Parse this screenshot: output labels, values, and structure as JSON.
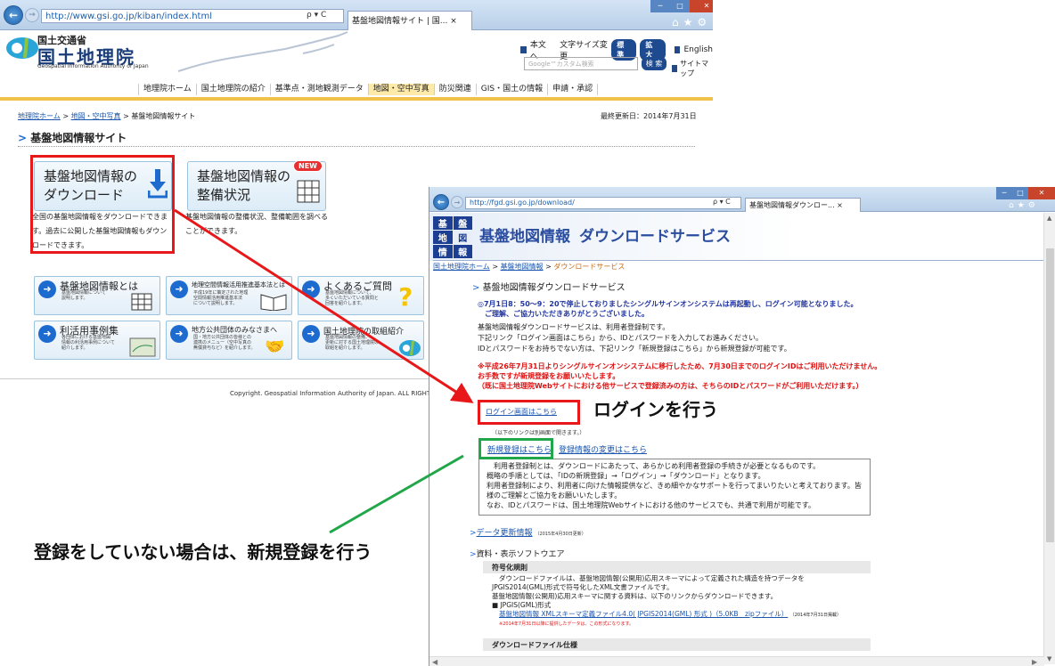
{
  "window1": {
    "url": "http://www.gsi.go.jp/kiban/index.html",
    "url_highlight": "gsi.go.jp",
    "tab_title": "基盤地図情報サイト | 国...",
    "logo": {
      "line1": "国土交通省",
      "line2": "国土地理院",
      "line3": "Geospatial Information Authority of Japan"
    },
    "header_links": {
      "text_only": "本文へ",
      "font_size": "文字サイズ変更",
      "std": "標 準",
      "large": "拡 大",
      "english": "English"
    },
    "search_placeholder": "Google™カスタム検索",
    "search_button": "検 索",
    "sitemap": "サイトマップ",
    "global_nav": [
      "地理院ホーム",
      "国土地理院の紹介",
      "基準点・測地観測データ",
      "地図・空中写真",
      "防災関連",
      "GIS・国土の情報",
      "申請・承認"
    ],
    "breadcrumb": {
      "home": "地理院ホーム",
      "sep": ">",
      "level2": "地図・空中写真",
      "current": "基盤地図情報サイト"
    },
    "last_updated": "最終更新日：2014年7月31日",
    "page_title": "基盤地図情報サイト",
    "download_tile": {
      "title_line1": "基盤地図情報の",
      "title_line2": "ダウンロード",
      "desc": "全国の基盤地図情報をダウンロードできます。過去に公開した基盤地図情報もダウンロードできます。"
    },
    "status_tile": {
      "title_line1": "基盤地図情報の",
      "title_line2": "整備状況",
      "new_badge": "NEW",
      "desc": "基盤地図情報の整備状況、整備範囲を調べることができます。"
    },
    "nav_tiles": [
      {
        "title": "基盤地図情報とは",
        "sub": "基盤地図情報について\n説明します。"
      },
      {
        "title": "地理空間情報活用推進基本法とは",
        "sub": "平成19年に策定された地理\n空間情報活用推進基本法\nについて説明します。"
      },
      {
        "title": "よくあるご質問",
        "sub": "基盤地図情報について、\n多くいただいている質問と\n回答を紹介します。"
      },
      {
        "title": "利活用事例集",
        "sub": "各団体における基盤地図\n情報の利活用事例について\n紹介します。"
      },
      {
        "title": "地方公共団体のみなさまへ",
        "sub": "国・地方公共団体の皆様との\n連携のメニュー（空中写真の\n無償貸与など）を紹介します。"
      },
      {
        "title": "国土地理院の取組紹介",
        "sub": "基盤地図情報の整備、\n更新に対する国土地理院の\n取組を紹介します。"
      }
    ],
    "copyright": "Copyright. Geospatial Information Authority of Japan. ALL RIGHT"
  },
  "window2": {
    "url": "http://fgd.gsi.go.jp/download/",
    "url_highlight": "gsi.go.jp",
    "tab_title": "基盤地図情報ダウンロー...",
    "banner_logo": {
      "a": "基",
      "b": "盤",
      "c": "地",
      "d": "図",
      "e": "情",
      "f": "報"
    },
    "banner_title": "基盤地図情報",
    "banner_subtitle": "ダウンロードサービス",
    "breadcrumb": {
      "home": "国土地理院ホーム",
      "sep": ">",
      "level2": "基盤地図情報",
      "current": "ダウンロードサービス"
    },
    "service_title": "基盤地図情報ダウンロードサービス",
    "notice_line1": "◎7月1日8：50～9：20で停止しておりましたシングルサインオンシステムは再起動し、ログイン可能となりました。",
    "notice_line2": "ご理解、ご協力いただきありがとうございました。",
    "intro_line1": "基盤地図情報ダウンロードサービスは、利用者登録制です。",
    "intro_line2": "下記リンク「ログイン画面はこちら」から、IDとパスワードを入力してお進みください。",
    "intro_line3": "IDとパスワードをお持ちでない方は、下記リンク「新規登録はこちら」から新規登録が可能です。",
    "red_line1": "※平成26年7月31日よりシングルサインオンシステムに移行したため、7月30日までのログインIDはご利用いただけません。",
    "red_line2": "お手数ですが新規登録をお願いいたします。",
    "red_line3": "（既に国土地理院Webサイトにおける他サービスで登録済みの方は、そちらのIDとパスワードがご利用いただけます。）",
    "login_link": "ログイン画面はこちら",
    "link_note": "（以下のリンクは別画面で開きます。）",
    "register_link": "新規登録はこちら",
    "change_link": "登録情報の変更はこちら",
    "box_line1": "利用者登録制とは、ダウンロードにあたって、あらかじめ利用者登録の手続きが必要となるものです。",
    "box_line2": "概略の手順としては、「IDの新規登録」→「ログイン」→「ダウンロード」となります。",
    "box_line3": "利用者登録制により、利用者に向けた情報提供など、きめ細やかなサポートを行ってまいりたいと考えております。皆",
    "box_line4": "様のご理解とご協力をお願いいたします。",
    "box_line5": "なお、IDとパスワードは、国土地理院Webサイトにおける他のサービスでも、共通で利用が可能です。",
    "update_link": "データ更新情報",
    "update_date": "（2015年4月30日更新）",
    "software_title": "資料・表示ソフトウエア",
    "section1_title": "符号化規則",
    "s1_line1": "ダウンロードファイルは、基盤地図情報(公開用)応用スキーマによって定義された構造を持つデータを",
    "s1_line2": "JPGIS2014(GML)形式で符号化したXML文書ファイルです。",
    "s1_line3": "基盤地図情報(公開用)応用スキーマに関する資料は、以下のリンクからダウンロードできます。",
    "s1_line4": "■ JPGIS(GML)形式",
    "s1_link": "基盤地図情報 XMLスキーマ定義ファイル4.0( JPGIS2014(GML) 形式 )（5.0KB　zipファイル）",
    "s1_link_date": "（2014年7月31日掲載）",
    "s1_note": "※2014年7月31日以降に提供したデータは、この形式になります。",
    "section2_title": "ダウンロードファイル仕様"
  },
  "annotations": {
    "login_callout": "ログインを行う",
    "register_callout": "登録をしていない場合は、新規登録を行う"
  },
  "colors": {
    "highlight_red": "#e8181a",
    "highlight_green": "#21a74a",
    "link": "#1a56b0",
    "notice_red": "#e01010"
  }
}
